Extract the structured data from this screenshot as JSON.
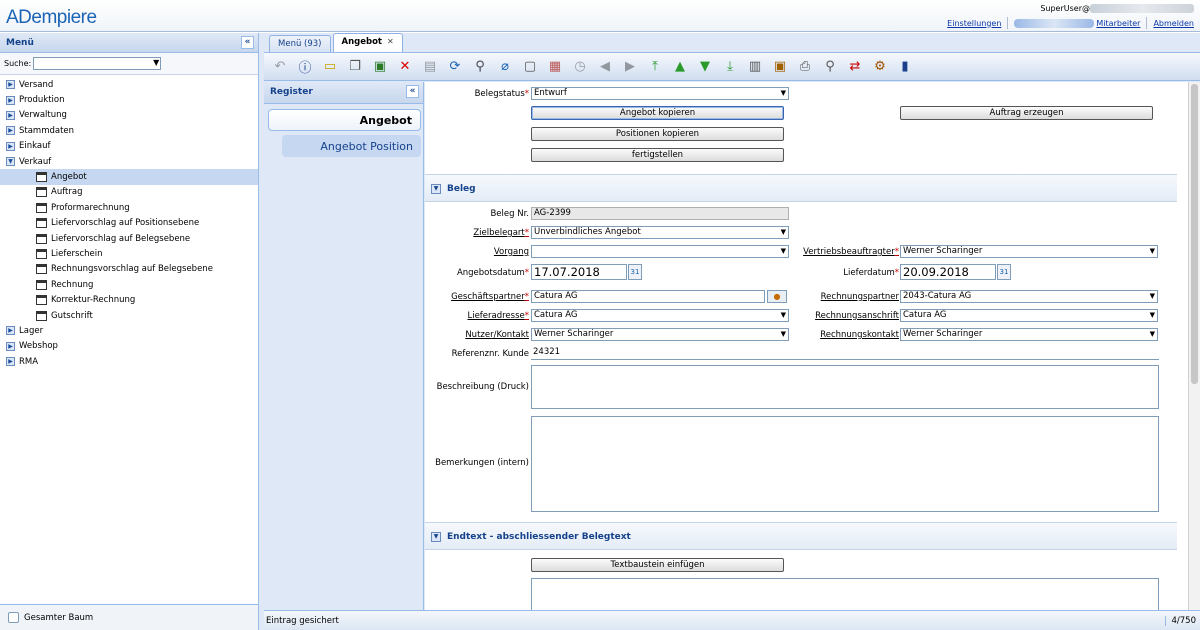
{
  "app": {
    "logo": "ADempiere"
  },
  "header": {
    "user": "SuperUser@",
    "links": {
      "settings": "Einstellungen",
      "employee": "Mitarbeiter",
      "logout": "Abmelden"
    }
  },
  "menu": {
    "title": "Menü",
    "search_label": "Suche:",
    "folders_top": [
      "Versand",
      "Produktion",
      "Verwaltung",
      "Stammdaten",
      "Einkauf",
      "Verkauf"
    ],
    "leaves": [
      "Angebot",
      "Auftrag",
      "Proformarechnung",
      "Liefervorschlag auf Positionsebene",
      "Liefervorschlag auf Belegsebene",
      "Lieferschein",
      "Rechnungsvorschlag auf Belegsebene",
      "Rechnung",
      "Korrektur-Rechnung",
      "Gutschrift"
    ],
    "folders_bottom": [
      "Lager",
      "Webshop",
      "RMA"
    ],
    "footer_checkbox": "Gesamter Baum"
  },
  "tabs": {
    "menu": "Menü (93)",
    "active": "Angebot",
    "close": "✕"
  },
  "register": {
    "title": "Register",
    "items": [
      "Angebot",
      "Angebot Position"
    ]
  },
  "form": {
    "status_label": "Belegstatus",
    "status_value": "Entwurf",
    "btn_copy_quote": "Angebot kopieren",
    "btn_copy_lines": "Positionen kopieren",
    "btn_complete": "fertigstellen",
    "btn_create_order": "Auftrag erzeugen",
    "section_beleg": "Beleg",
    "docno_label": "Beleg Nr.",
    "docno_value": "AG-2399",
    "doctype_label": "Zielbelegart",
    "doctype_value": "Unverbindliches Angebot",
    "project_label": "Vorgang",
    "project_value": "",
    "salesrep_label": "Vertriebsbeauftragter",
    "salesrep_value": "Werner Scharinger",
    "date_label": "Angebotsdatum",
    "date_value": "17.07.2018",
    "delivery_label": "Lieferdatum",
    "delivery_value": "20.09.2018",
    "partner_label": "Geschäftspartner",
    "partner_value": "Catura AG",
    "invpartner_label": "Rechnungspartner",
    "invpartner_value": "2043-Catura AG",
    "shipaddr_label": "Lieferadresse",
    "shipaddr_value": "Catura AG",
    "invaddr_label": "Rechnungsanschrift",
    "invaddr_value": "Catura AG",
    "contact_label": "Nutzer/Kontakt",
    "contact_value": "Werner Scharinger",
    "invcontact_label": "Rechnungskontakt",
    "invcontact_value": "Werner Scharinger",
    "ref_label": "Referenznr. Kunde",
    "ref_value": "24321",
    "desc_label": "Beschreibung (Druck)",
    "notes_label": "Bemerkungen (intern)",
    "section_endtext": "Endtext - abschliessender Belegtext",
    "btn_insert_text": "Textbaustein einfügen"
  },
  "status": {
    "message": "Eintrag gesichert",
    "count": "4/750"
  }
}
